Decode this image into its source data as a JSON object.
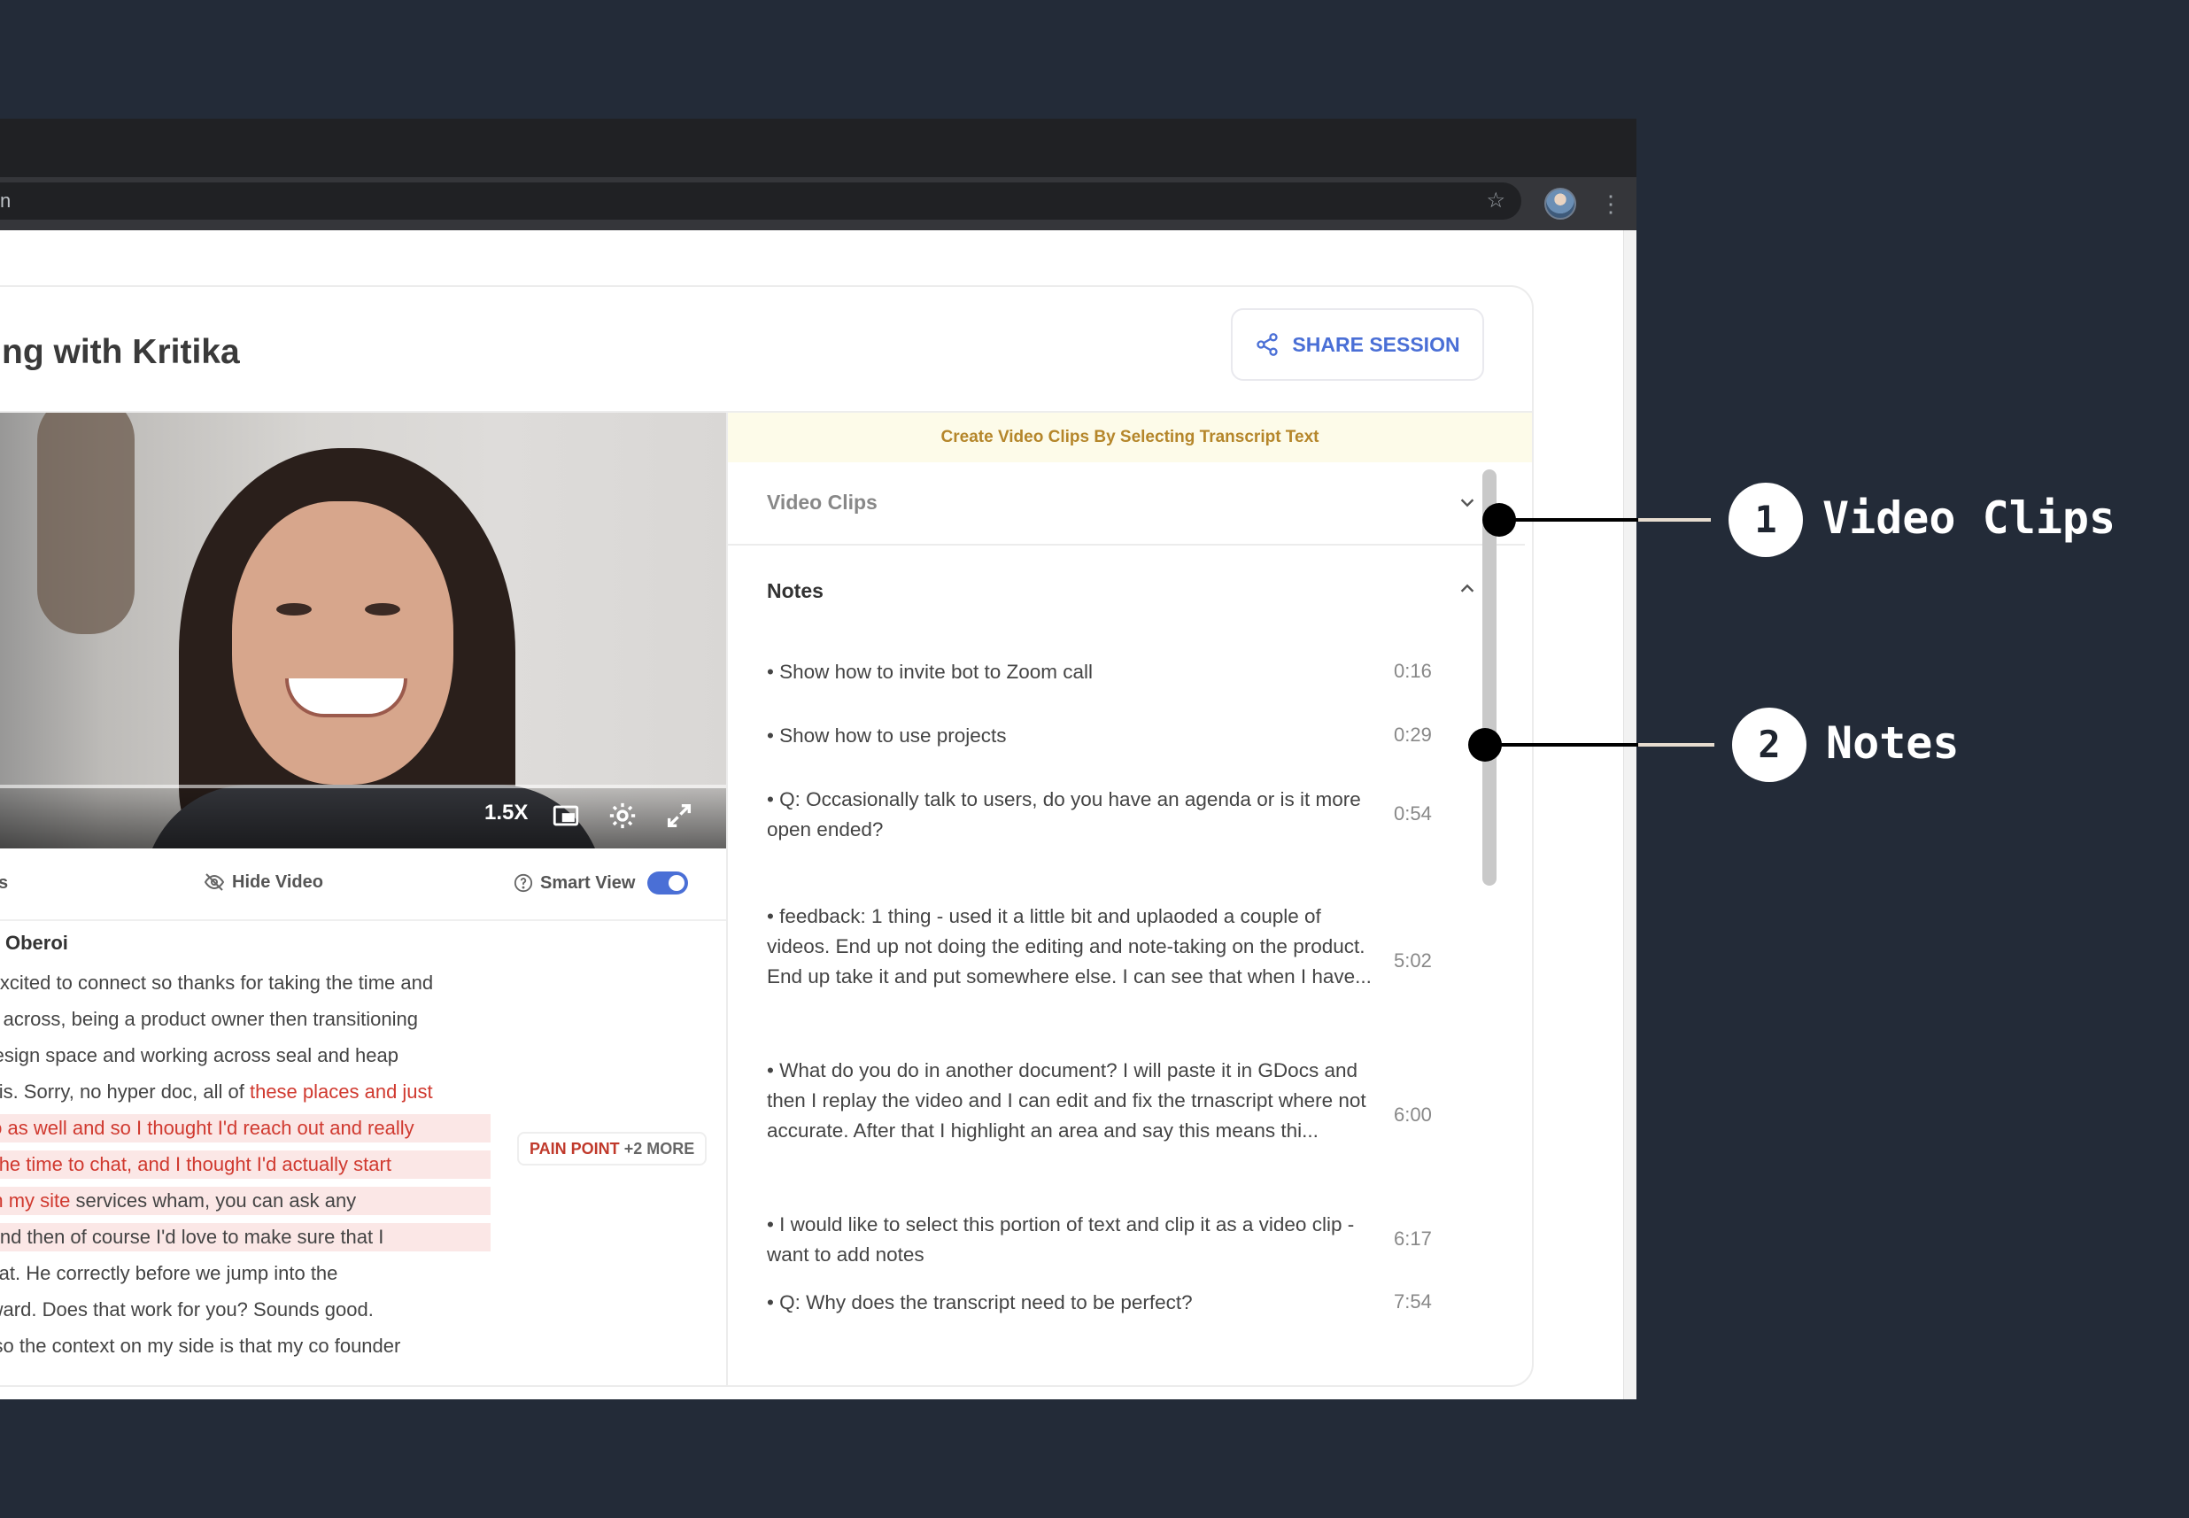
{
  "browser": {
    "url_fragment": "n",
    "star_icon": "star-icon",
    "menu_icon": "kebab-menu-icon"
  },
  "session": {
    "title": "ng with Kritika",
    "share_label": "SHARE SESSION"
  },
  "video": {
    "speed_label": "1.5X",
    "options": {
      "left_label": "s",
      "hide_video_label": "Hide Video",
      "smart_view_label": "Smart View",
      "smart_view_on": true
    }
  },
  "transcript": {
    "speaker": "Oberoi",
    "lines": [
      {
        "normal": "er excited to connect so thanks for taking the time and"
      },
      {
        "normal": "nce across, being a product owner then transitioning"
      },
      {
        "normal": "e design space and working across seal and heap"
      },
      {
        "normal": "e this. Sorry, no hyper doc, all of ",
        "highlight": "these places and just"
      },
      {
        "highlight": "folio as well and so I thought I'd reach out and really"
      },
      {
        "highlight": "ng the time to chat, and I thought I'd actually start"
      },
      {
        "highlight": "s on my site",
        "normal": " services wham, you can ask any"
      },
      {
        "normal": "e. And then of course I'd love to make sure that I"
      },
      {
        "normal": "ork at. He correctly before we jump into the"
      },
      {
        "normal": " forward. Does that work for you? Sounds good."
      },
      {
        "normal": "m, so the context on my side is that my co founder"
      }
    ],
    "tag": {
      "label": "PAIN POINT",
      "more": "+2 MORE"
    }
  },
  "panel": {
    "banner": "Create Video Clips By Selecting Transcript Text",
    "video_clips_label": "Video Clips",
    "notes_label": "Notes",
    "notes": [
      {
        "text": "• Show how to invite bot to Zoom call",
        "time": "0:16"
      },
      {
        "text": "• Show how to use projects",
        "time": "0:29"
      },
      {
        "text": "• Q: Occasionally talk to users, do you have an agenda or is it more open ended?",
        "time": "0:54"
      },
      {
        "text": "• feedback: 1 thing - used it a little bit and uplaoded a couple of videos. End up not doing the editing and note-taking on the product. End up take it and put somewhere else. I can see that when I have...",
        "time": "5:02"
      },
      {
        "text": "• What do you do in another document? I will paste it in GDocs and then I replay the video and I can edit and fix the trnascript where not accurate. After that I highlight an area and say this means thi...",
        "time": "6:00"
      },
      {
        "text": "• I would like to select this portion of text and clip it as a video clip - want to add notes",
        "time": "6:17"
      },
      {
        "text": "• Q: Why does the transcript need to be perfect?",
        "time": "7:54"
      }
    ]
  },
  "annotations": [
    {
      "number": "1",
      "label": "Video Clips"
    },
    {
      "number": "2",
      "label": "Notes"
    }
  ],
  "colors": {
    "background": "#232b38",
    "accent": "#4a6fd6",
    "highlight": "#d0392f",
    "banner_text": "#b5862a"
  }
}
